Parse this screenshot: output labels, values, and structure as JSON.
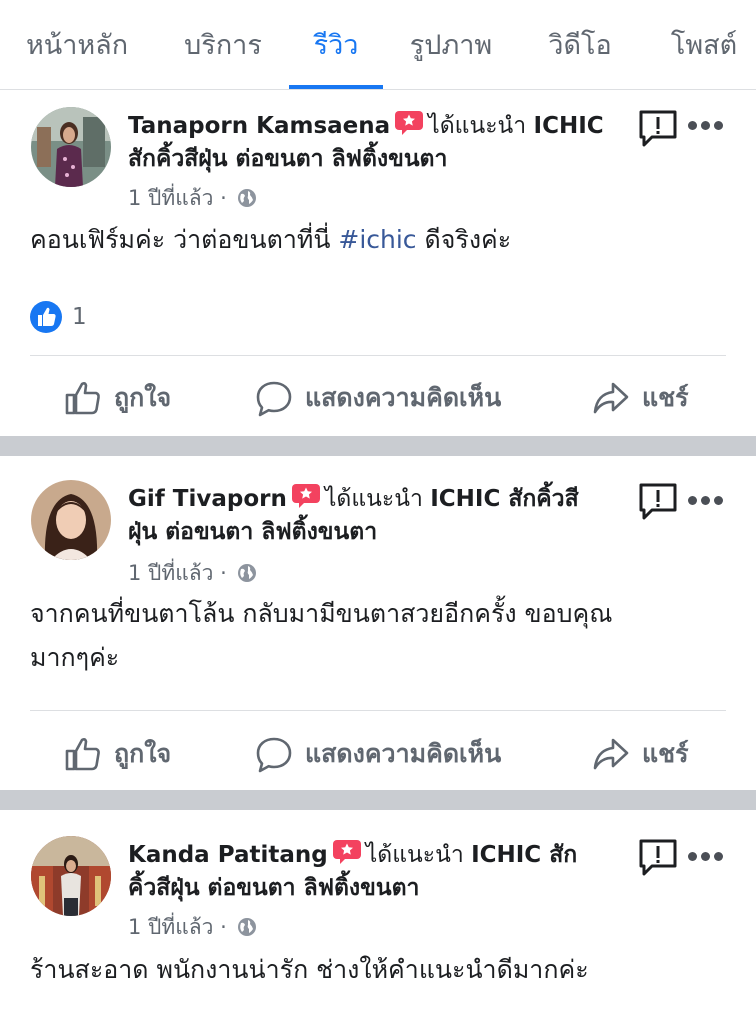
{
  "tabs": [
    {
      "label": "หน้าหลัก",
      "active": false
    },
    {
      "label": "บริการ",
      "active": false
    },
    {
      "label": "รีวิว",
      "active": true
    },
    {
      "label": "รูปภาพ",
      "active": false
    },
    {
      "label": "วิดีโอ",
      "active": false
    },
    {
      "label": "โพสต์",
      "active": false
    }
  ],
  "colors": {
    "accent": "#1877f2",
    "badge": "#f3425f",
    "separator": "#c9ccd1"
  },
  "actions": {
    "like": "ถูกใจ",
    "comment": "แสดงความคิดเห็น",
    "share": "แชร์"
  },
  "posts": [
    {
      "author": "Tanaporn Kamsaena",
      "recommends": "ได้แนะนำ",
      "page_line1": "ICHIC",
      "page_line2": "สักคิ้วสีฝุ่น ต่อขนตา ลิฟติ้งขนตา",
      "time": "1 ปีที่แล้ว",
      "dot": "·",
      "text_before": "คอนเฟิร์มค่ะ ว่าต่อขนตาที่นี่ ",
      "hashtag": "#ichic",
      "text_after": "  ดีจริงค่ะ",
      "reaction_count": "1"
    },
    {
      "author": "Gif Tivaporn",
      "recommends": "ได้แนะนำ",
      "page_line1": "ICHIC สักคิ้วสี",
      "page_line2": "ฝุ่น ต่อขนตา ลิฟติ้งขนตา",
      "time": "1 ปีที่แล้ว",
      "dot": "·",
      "text_line1": "จากคนที่ขนตาโล้น กลับมามีขนตาสวยอีกครั้ง ขอบคุณ",
      "text_line2": "มากๆค่ะ"
    },
    {
      "author": "Kanda Patitang",
      "recommends": "ได้แนะนำ",
      "page_line1": "ICHIC สัก",
      "page_line2": "คิ้วสีฝุ่น ต่อขนตา ลิฟติ้งขนตา",
      "time": "1 ปีที่แล้ว",
      "dot": "·",
      "text_line1": "ร้านสะอาด พนักงานน่ารัก ช่างให้คำแนะนำดีมากค่ะ"
    }
  ]
}
